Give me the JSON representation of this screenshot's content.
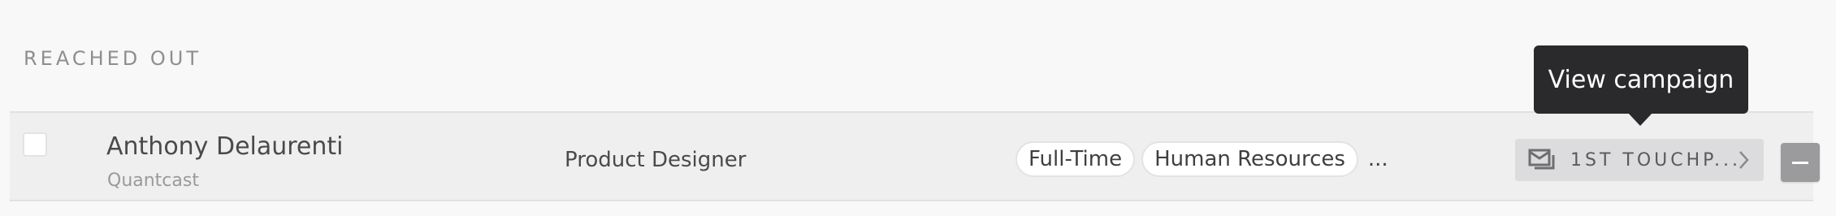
{
  "section": {
    "label": "REACHED OUT"
  },
  "candidate": {
    "name": "Anthony Delaurenti",
    "company": "Quantcast",
    "title": "Product Designer",
    "tags": [
      "Full-Time",
      "Human Resources"
    ],
    "tags_more": "...",
    "campaign_label": "1ST TOUCHP...",
    "campaign_icon": "mail-stack-icon",
    "remove_icon": "minus-icon"
  },
  "tooltip": {
    "text": "View campaign"
  },
  "colors": {
    "background": "#f8f8f8",
    "row_background": "#efeff0",
    "tooltip_background": "#2a2a2c",
    "campaign_background": "#dcdcde",
    "minus_button": "#9b9b9e"
  }
}
